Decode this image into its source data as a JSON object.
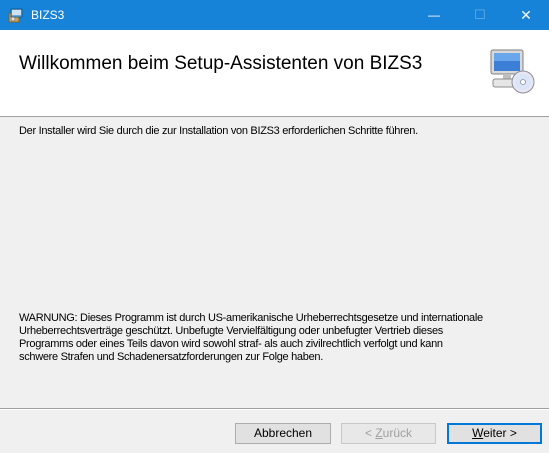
{
  "window": {
    "title": "BIZS3",
    "controls": {
      "minimize": "—",
      "maximize": "☐",
      "close": "✕"
    },
    "titlebar_color": "#1683d8",
    "app_icon": "installer-package-icon"
  },
  "header": {
    "title": "Willkommen beim Setup-Assistenten von BIZS3",
    "icon": "computer-cd-icon"
  },
  "body": {
    "intro": "Der Installer wird Sie durch die zur Installation von BIZS3 erforderlichen Schritte führen.",
    "warning_lines": [
      "WARNUNG: Dieses Programm ist durch US-amerikanische Urheberrechtsgesetze und internationale",
      "Urheberrechtsverträge geschützt. Unbefugte Vervielfältigung oder unbefugter Vertrieb dieses",
      "Programms oder eines Teils davon wird sowohl straf- als auch zivilrechtlich verfolgt und kann",
      "schwere Strafen und Schadenersatzforderungen zur Folge haben."
    ]
  },
  "buttons": {
    "cancel": "Abbrechen",
    "back_prefix": "< ",
    "back_accel": "Z",
    "back_rest": "urück",
    "next_accel": "W",
    "next_rest": "eiter >",
    "accent": "#0078d7"
  }
}
